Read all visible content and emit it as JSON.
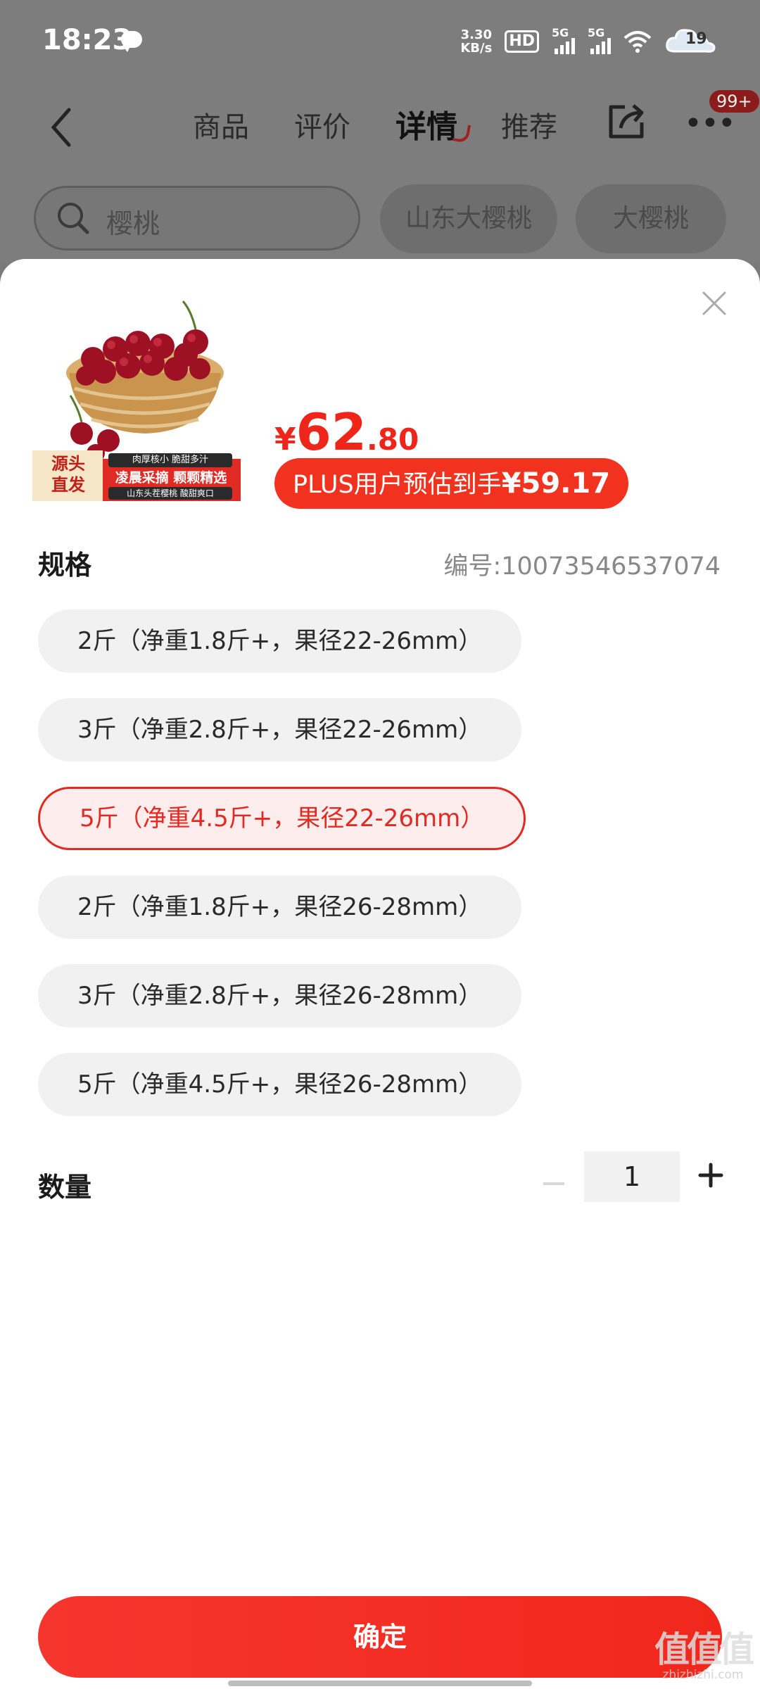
{
  "status_bar": {
    "time": "18:23",
    "net_speed_value": "3.30",
    "net_speed_unit": "KB/s",
    "hd_label": "HD",
    "signal1_label": "5G",
    "signal2_label": "5G",
    "weather_temp": "19"
  },
  "nav": {
    "tabs": [
      "商品",
      "评价",
      "详情",
      "推荐"
    ],
    "active_tab": "详情",
    "badge": "99+"
  },
  "search": {
    "placeholder": "樱桃",
    "chips": [
      "山东大樱桃",
      "大樱桃"
    ]
  },
  "product": {
    "image_tags": {
      "corner": [
        "源头",
        "直发"
      ],
      "line1": "肉厚核小 脆甜多汁",
      "line2": "凌晨采摘 颗颗精选",
      "line3": "山东头茬樱桃 酸甜爽口"
    },
    "price_currency": "¥",
    "price_integer": "62",
    "price_decimal": ".80",
    "plus_label": "PLUS用户预估到手",
    "plus_price": "¥59.17",
    "sku_label": "编号:10073546537074"
  },
  "spec": {
    "title": "规格",
    "selected_index": 2,
    "options": [
      "2斤（净重1.8斤+，果径22-26mm）",
      "3斤（净重2.8斤+，果径22-26mm）",
      "5斤（净重4.5斤+，果径22-26mm）",
      "2斤（净重1.8斤+，果径26-28mm）",
      "3斤（净重2.8斤+，果径26-28mm）",
      "5斤（净重4.5斤+，果径26-28mm）"
    ]
  },
  "quantity": {
    "label": "数量",
    "value": "1"
  },
  "confirm_label": "确定",
  "watermark": {
    "mark": "值值值",
    "domain": "zhizhizhi.com"
  },
  "colors": {
    "accent": "#f0251a",
    "selected_bg": "#fdeded",
    "overlay": "#7d7d7d"
  }
}
